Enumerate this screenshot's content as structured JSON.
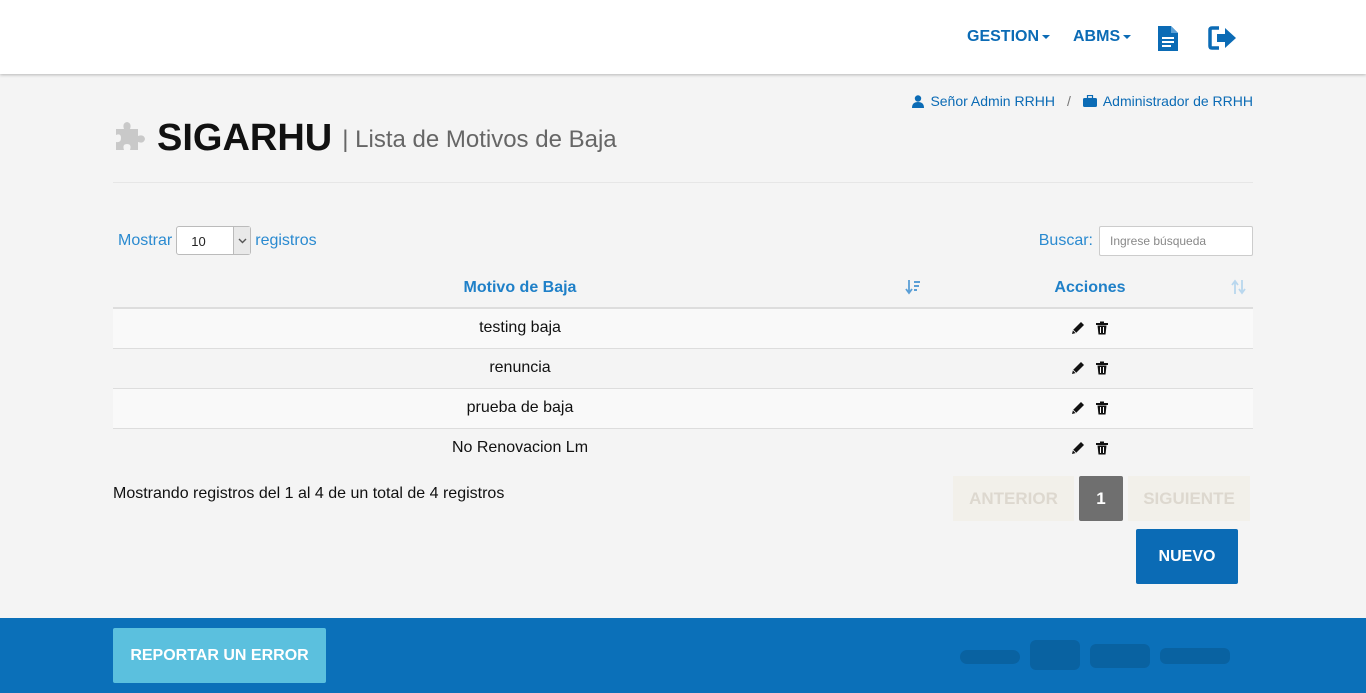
{
  "nav": {
    "menus": [
      {
        "label": "GESTION"
      },
      {
        "label": "ABMS"
      }
    ],
    "doc_icon": "document-icon",
    "exit_icon": "sign-out-icon"
  },
  "userinfo": {
    "user": "Señor Admin RRHH",
    "separator": "/",
    "role": "Administrador de RRHH"
  },
  "header": {
    "brand": "SIGARHU",
    "subtitle": "| Lista de Motivos de Baja"
  },
  "controls": {
    "show_label": "Mostrar",
    "page_size": "10",
    "records_label": "registros",
    "search_label": "Buscar:",
    "search_placeholder": "Ingrese búsqueda",
    "search_value": ""
  },
  "table": {
    "columns": [
      "Motivo de Baja",
      "Acciones"
    ],
    "rows": [
      {
        "motivo": "testing baja"
      },
      {
        "motivo": "renuncia"
      },
      {
        "motivo": "prueba de baja"
      },
      {
        "motivo": "No Renovacion Lm"
      }
    ]
  },
  "info": "Mostrando registros del 1 al 4 de un total de 4 registros",
  "pagination": {
    "prev": "ANTERIOR",
    "current": "1",
    "next": "SIGUIENTE"
  },
  "buttons": {
    "nuevo": "NUEVO",
    "report": "REPORTAR UN ERROR"
  },
  "colors": {
    "primary": "#0b6bb5",
    "link": "#2a8ad0",
    "footer": "#0b70b9",
    "report": "#5bc0de"
  }
}
